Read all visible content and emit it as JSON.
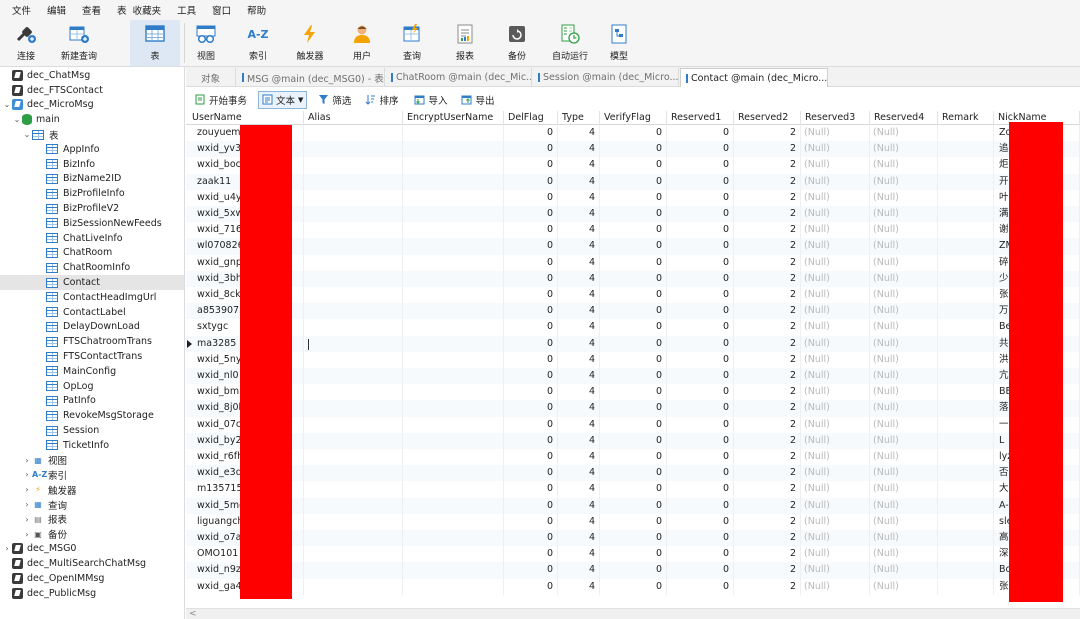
{
  "menu": [
    "文件",
    "编辑",
    "查看",
    "表",
    "收藏夹",
    "工具",
    "窗口",
    "帮助"
  ],
  "toolbar": [
    {
      "label": "连接",
      "icon": "connect-icon"
    },
    {
      "label": "新建查询",
      "icon": "new-query-icon"
    },
    {
      "label": "表",
      "icon": "table-icon",
      "active": true
    },
    {
      "label": "视图",
      "icon": "view-icon"
    },
    {
      "label": "索引",
      "icon": "index-icon",
      "glyph": "A-Z"
    },
    {
      "label": "触发器",
      "icon": "trigger-icon"
    },
    {
      "label": "用户",
      "icon": "user-icon"
    },
    {
      "label": "查询",
      "icon": "query-icon"
    },
    {
      "label": "报表",
      "icon": "report-icon"
    },
    {
      "label": "备份",
      "icon": "backup-icon"
    },
    {
      "label": "自动运行",
      "icon": "automation-icon"
    },
    {
      "label": "模型",
      "icon": "model-icon"
    }
  ],
  "sidebar": {
    "top_dbs": [
      "dec_ChatMsg",
      "dec_FTSContact"
    ],
    "open_db": "dec_MicroMsg",
    "schema": "main",
    "tables_group": "表",
    "tables": [
      "AppInfo",
      "BizInfo",
      "BizName2ID",
      "BizProfileInfo",
      "BizProfileV2",
      "BizSessionNewFeeds",
      "ChatLiveInfo",
      "ChatRoom",
      "ChatRoomInfo",
      "Contact",
      "ContactHeadImgUrl",
      "ContactLabel",
      "DelayDownLoad",
      "FTSChatroomTrans",
      "FTSContactTrans",
      "MainConfig",
      "OpLog",
      "PatInfo",
      "RevokeMsgStorage",
      "Session",
      "TicketInfo"
    ],
    "selected_table": "Contact",
    "groups": [
      {
        "label": "视图",
        "glyph": "▦"
      },
      {
        "label": "索引",
        "glyph": "A-Z"
      },
      {
        "label": "触发器",
        "glyph": "⚡"
      },
      {
        "label": "查询",
        "glyph": "▦"
      },
      {
        "label": "报表",
        "glyph": "▤"
      },
      {
        "label": "备份",
        "glyph": "▣"
      }
    ],
    "bottom_dbs": [
      "dec_MSG0",
      "dec_MultiSearchChatMsg",
      "dec_OpenIMMsg",
      "dec_PublicMsg"
    ]
  },
  "tabs": [
    {
      "label": "对象"
    },
    {
      "label": "MSG @main (dec_MSG0) - 表"
    },
    {
      "label": "ChatRoom @main (dec_Mic..."
    },
    {
      "label": "Session @main (dec_Micro..."
    },
    {
      "label": "Contact @main (dec_Micro...",
      "active": true
    }
  ],
  "objbar": {
    "begin_tx": "开始事务",
    "text": "文本",
    "filter": "筛选",
    "sort": "排序",
    "import": "导入",
    "export": "导出"
  },
  "grid": {
    "columns": [
      "UserName",
      "Alias",
      "EncryptUserName",
      "DelFlag",
      "Type",
      "VerifyFlag",
      "Reserved1",
      "Reserved2",
      "Reserved3",
      "Reserved4",
      "Remark",
      "NickName"
    ],
    "null_text": "(Null)",
    "rows": [
      {
        "u": "zouyuemi",
        "nick": "Zo"
      },
      {
        "u": "wxid_yv3n",
        "nick": "追"
      },
      {
        "u": "wxid_boc",
        "nick": "炬"
      },
      {
        "u": "zaak11",
        "nick": "开"
      },
      {
        "u": "wxid_u4yy",
        "nick": "叶"
      },
      {
        "u": "wxid_5xw",
        "nick": "满"
      },
      {
        "u": "wxid_716",
        "nick": "谢"
      },
      {
        "u": "wl070826",
        "nick": "ZM"
      },
      {
        "u": "wxid_gnp",
        "nick": "碎"
      },
      {
        "u": "wxid_3bh",
        "nick": "少"
      },
      {
        "u": "wxid_8ckl",
        "nick": "张"
      },
      {
        "u": "a8539073",
        "nick": "万"
      },
      {
        "u": "sxtygc",
        "nick": "Be"
      },
      {
        "u": "ma3285",
        "nick": "共"
      },
      {
        "u": "wxid_5ny",
        "nick": "洪"
      },
      {
        "u": "wxid_nl0",
        "nick": "亢"
      },
      {
        "u": "wxid_bmr",
        "nick": "BE"
      },
      {
        "u": "wxid_8j0h",
        "nick": "落"
      },
      {
        "u": "wxid_07ci",
        "nick": "一"
      },
      {
        "u": "wxid_by2",
        "nick": "L"
      },
      {
        "u": "wxid_r6fh",
        "nick": "lyz"
      },
      {
        "u": "wxid_e3q",
        "nick": "否"
      },
      {
        "u": "m135715",
        "nick": "大"
      },
      {
        "u": "wxid_5mc",
        "nick": "A-"
      },
      {
        "u": "liguangch",
        "nick": "sle"
      },
      {
        "u": "wxid_o7a",
        "nick": "高"
      },
      {
        "u": "OMO101",
        "nick": "深"
      },
      {
        "u": "wxid_n9zt",
        "nick": "Bo"
      },
      {
        "u": "wxid_ga4",
        "nick": "张"
      }
    ],
    "row_values": {
      "DelFlag": "0",
      "Type": "4",
      "VerifyFlag": "0",
      "Reserved1": "0",
      "Reserved2": "2"
    },
    "current_row_index": 13
  },
  "colors": {
    "redaction": "#ff0000",
    "accent": "#2f7cc9",
    "selection": "#e5e5e5"
  }
}
